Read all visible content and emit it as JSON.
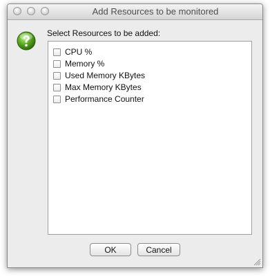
{
  "dialog": {
    "title": "Add Resources to be monitored",
    "prompt": "Select Resources to be added:",
    "icon": "help-question-icon",
    "resources": [
      {
        "label": "CPU %",
        "checked": false
      },
      {
        "label": "Memory %",
        "checked": false
      },
      {
        "label": "Used Memory KBytes",
        "checked": false
      },
      {
        "label": "Max Memory KBytes",
        "checked": false
      },
      {
        "label": "Performance Counter",
        "checked": false
      }
    ],
    "ok_label": "OK",
    "cancel_label": "Cancel"
  },
  "colors": {
    "window_bg": "#ececec",
    "help_icon_green": "#5aa81f"
  }
}
